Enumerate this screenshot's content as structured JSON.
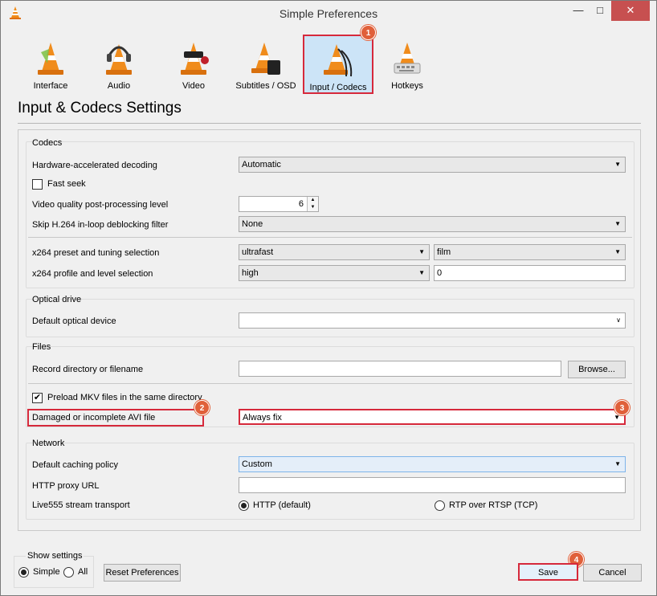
{
  "window": {
    "title": "Simple Preferences",
    "minimize": "—",
    "maximize": "□",
    "close": "✕"
  },
  "toolbar": {
    "items": [
      {
        "label": "Interface",
        "icon": "vlc-cone-interface-icon"
      },
      {
        "label": "Audio",
        "icon": "vlc-cone-headphones-icon"
      },
      {
        "label": "Video",
        "icon": "vlc-cone-glasses-icon"
      },
      {
        "label": "Subtitles / OSD",
        "icon": "vlc-cone-subtitles-icon"
      },
      {
        "label": "Input / Codecs",
        "icon": "vlc-cone-cables-icon",
        "selected": true
      },
      {
        "label": "Hotkeys",
        "icon": "vlc-cone-keyboard-icon"
      }
    ]
  },
  "page_title": "Input & Codecs Settings",
  "badges": {
    "one": "1",
    "two": "2",
    "three": "3",
    "four": "4"
  },
  "codecs": {
    "title": "Codecs",
    "hw_decoding_label": "Hardware-accelerated decoding",
    "hw_decoding_value": "Automatic",
    "fast_seek_label": "Fast seek",
    "fast_seek_checked": false,
    "pp_level_label": "Video quality post-processing level",
    "pp_level_value": "6",
    "skip_h264_label": "Skip H.264 in-loop deblocking filter",
    "skip_h264_value": "None",
    "x264_preset_label": "x264 preset and tuning selection",
    "x264_preset_value": "ultrafast",
    "x264_tune_value": "film",
    "x264_profile_label": "x264 profile and level selection",
    "x264_profile_value": "high",
    "x264_level_value": "0"
  },
  "optical": {
    "title": "Optical drive",
    "device_label": "Default optical device",
    "device_value": ""
  },
  "files": {
    "title": "Files",
    "record_label": "Record directory or filename",
    "record_value": "",
    "browse_label": "Browse...",
    "preload_mkv_label": "Preload MKV files in the same directory",
    "preload_mkv_checked": true,
    "avi_label": "Damaged or incomplete AVI file",
    "avi_value": "Always fix"
  },
  "network": {
    "title": "Network",
    "caching_label": "Default caching policy",
    "caching_value": "Custom",
    "proxy_label": "HTTP proxy URL",
    "proxy_value": "",
    "live555_label": "Live555 stream transport",
    "http_option": "HTTP (default)",
    "rtsp_option": "RTP over RTSP (TCP)",
    "selected": "HTTP (default)"
  },
  "bottom": {
    "show_settings_label": "Show settings",
    "simple_label": "Simple",
    "all_label": "All",
    "selected": "Simple",
    "reset_label": "Reset Preferences",
    "save_label": "Save",
    "cancel_label": "Cancel"
  },
  "colors": {
    "highlight": "#d6293b",
    "badge": "#e0603a",
    "selected_tab": "#cce4f7",
    "vlc_orange": "#f08c1c"
  }
}
